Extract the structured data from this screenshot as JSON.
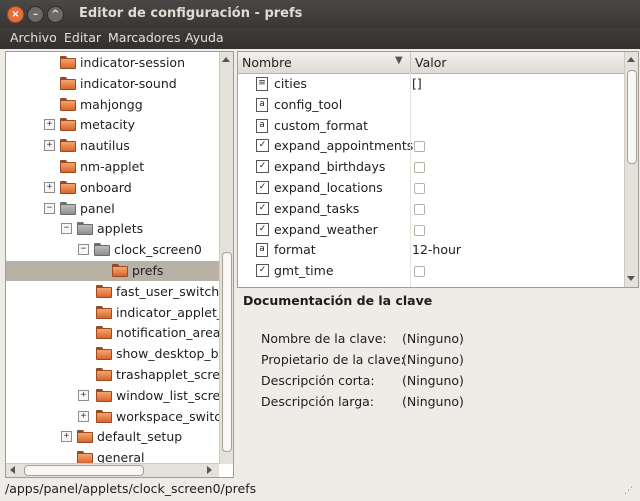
{
  "window": {
    "title": "Editor de configuración - prefs"
  },
  "menubar": [
    "Archivo",
    "Editar",
    "Marcadores",
    "Ayuda"
  ],
  "tree": [
    {
      "label": "indicator-session",
      "expander": "",
      "icon": "folder"
    },
    {
      "label": "indicator-sound",
      "expander": "",
      "icon": "folder"
    },
    {
      "label": "mahjongg",
      "expander": "",
      "icon": "folder"
    },
    {
      "label": "metacity",
      "expander": "+",
      "icon": "folder"
    },
    {
      "label": "nautilus",
      "expander": "+",
      "icon": "folder"
    },
    {
      "label": "nm-applet",
      "expander": "",
      "icon": "folder"
    },
    {
      "label": "onboard",
      "expander": "+",
      "icon": "folder"
    },
    {
      "label": "panel",
      "expander": "−",
      "icon": "folder-open"
    },
    {
      "label": "applets",
      "expander": "−",
      "icon": "folder-open"
    },
    {
      "label": "clock_screen0",
      "expander": "−",
      "icon": "folder-open"
    },
    {
      "label": "prefs",
      "expander": "",
      "icon": "folder",
      "selected": true
    },
    {
      "label": "fast_user_switch_",
      "expander": "",
      "icon": "folder"
    },
    {
      "label": "indicator_applet_s",
      "expander": "",
      "icon": "folder"
    },
    {
      "label": "notification_area_",
      "expander": "",
      "icon": "folder"
    },
    {
      "label": "show_desktop_bu",
      "expander": "",
      "icon": "folder"
    },
    {
      "label": "trashapplet_scree",
      "expander": "",
      "icon": "folder"
    },
    {
      "label": "window_list_scree",
      "expander": "+",
      "icon": "folder"
    },
    {
      "label": "workspace_switch",
      "expander": "+",
      "icon": "folder"
    },
    {
      "label": "default_setup",
      "expander": "+",
      "icon": "folder"
    },
    {
      "label": "general",
      "expander": "",
      "icon": "folder"
    }
  ],
  "keys": {
    "columns": {
      "name": "Nombre",
      "value": "Valor"
    },
    "rows": [
      {
        "name": "cities",
        "type": "list",
        "value": "[]"
      },
      {
        "name": "config_tool",
        "type": "string",
        "value": ""
      },
      {
        "name": "custom_format",
        "type": "string",
        "value": ""
      },
      {
        "name": "expand_appointments",
        "type": "bool",
        "value": ""
      },
      {
        "name": "expand_birthdays",
        "type": "bool",
        "value": ""
      },
      {
        "name": "expand_locations",
        "type": "bool",
        "value": ""
      },
      {
        "name": "expand_tasks",
        "type": "bool",
        "value": ""
      },
      {
        "name": "expand_weather",
        "type": "bool",
        "value": ""
      },
      {
        "name": "format",
        "type": "string",
        "value": "12-hour"
      },
      {
        "name": "gmt_time",
        "type": "bool",
        "value": ""
      }
    ]
  },
  "doc": {
    "title": "Documentación de la clave",
    "fields": [
      {
        "label": "Nombre de la clave:",
        "value": "(Ninguno)"
      },
      {
        "label": "Propietario de la clave:",
        "value": "(Ninguno)"
      },
      {
        "label": "Descripción corta:",
        "value": "(Ninguno)"
      },
      {
        "label": "Descripción larga:",
        "value": "(Ninguno)"
      }
    ]
  },
  "status": {
    "path": "/apps/panel/applets/clock_screen0/prefs"
  },
  "colors": {
    "titlebar": "#3c3b37",
    "close_button": "#e1703e",
    "selection": "#b8b1a6",
    "folder": "#e8854a"
  }
}
